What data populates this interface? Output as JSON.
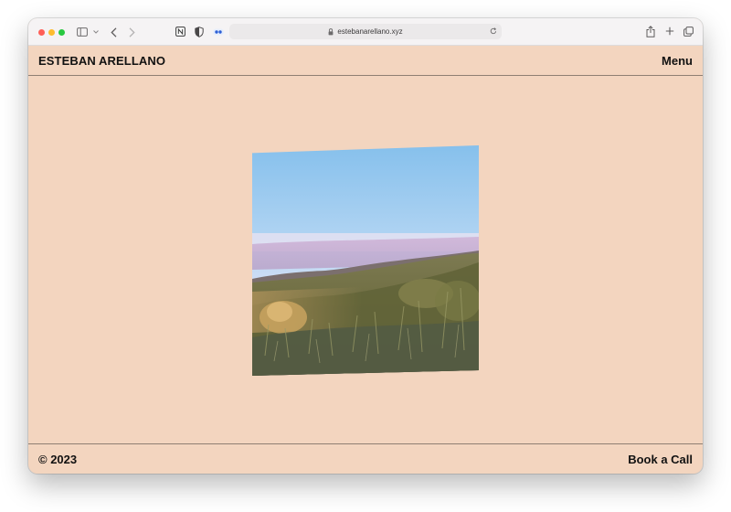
{
  "browser": {
    "url": "estebanarellano.xyz",
    "traffic_colors": {
      "close": "#ff5f57",
      "minimize": "#febc2e",
      "zoom": "#28c840"
    },
    "icons": [
      "sidebar-icon",
      "chevron-down-icon",
      "back-icon",
      "forward-icon",
      "notion-extension-icon",
      "shield-extension-icon",
      "dots-extension-icon",
      "lock-icon",
      "reload-icon",
      "share-icon",
      "new-tab-icon",
      "tabs-overview-icon"
    ]
  },
  "site": {
    "brand": "ESTEBAN ARELLANO",
    "menu_label": "Menu",
    "copyright": "© 2023",
    "cta_label": "Book a Call",
    "colors": {
      "background": "#f3d5bf",
      "text": "#111111",
      "rule": "#8f7f73"
    }
  }
}
